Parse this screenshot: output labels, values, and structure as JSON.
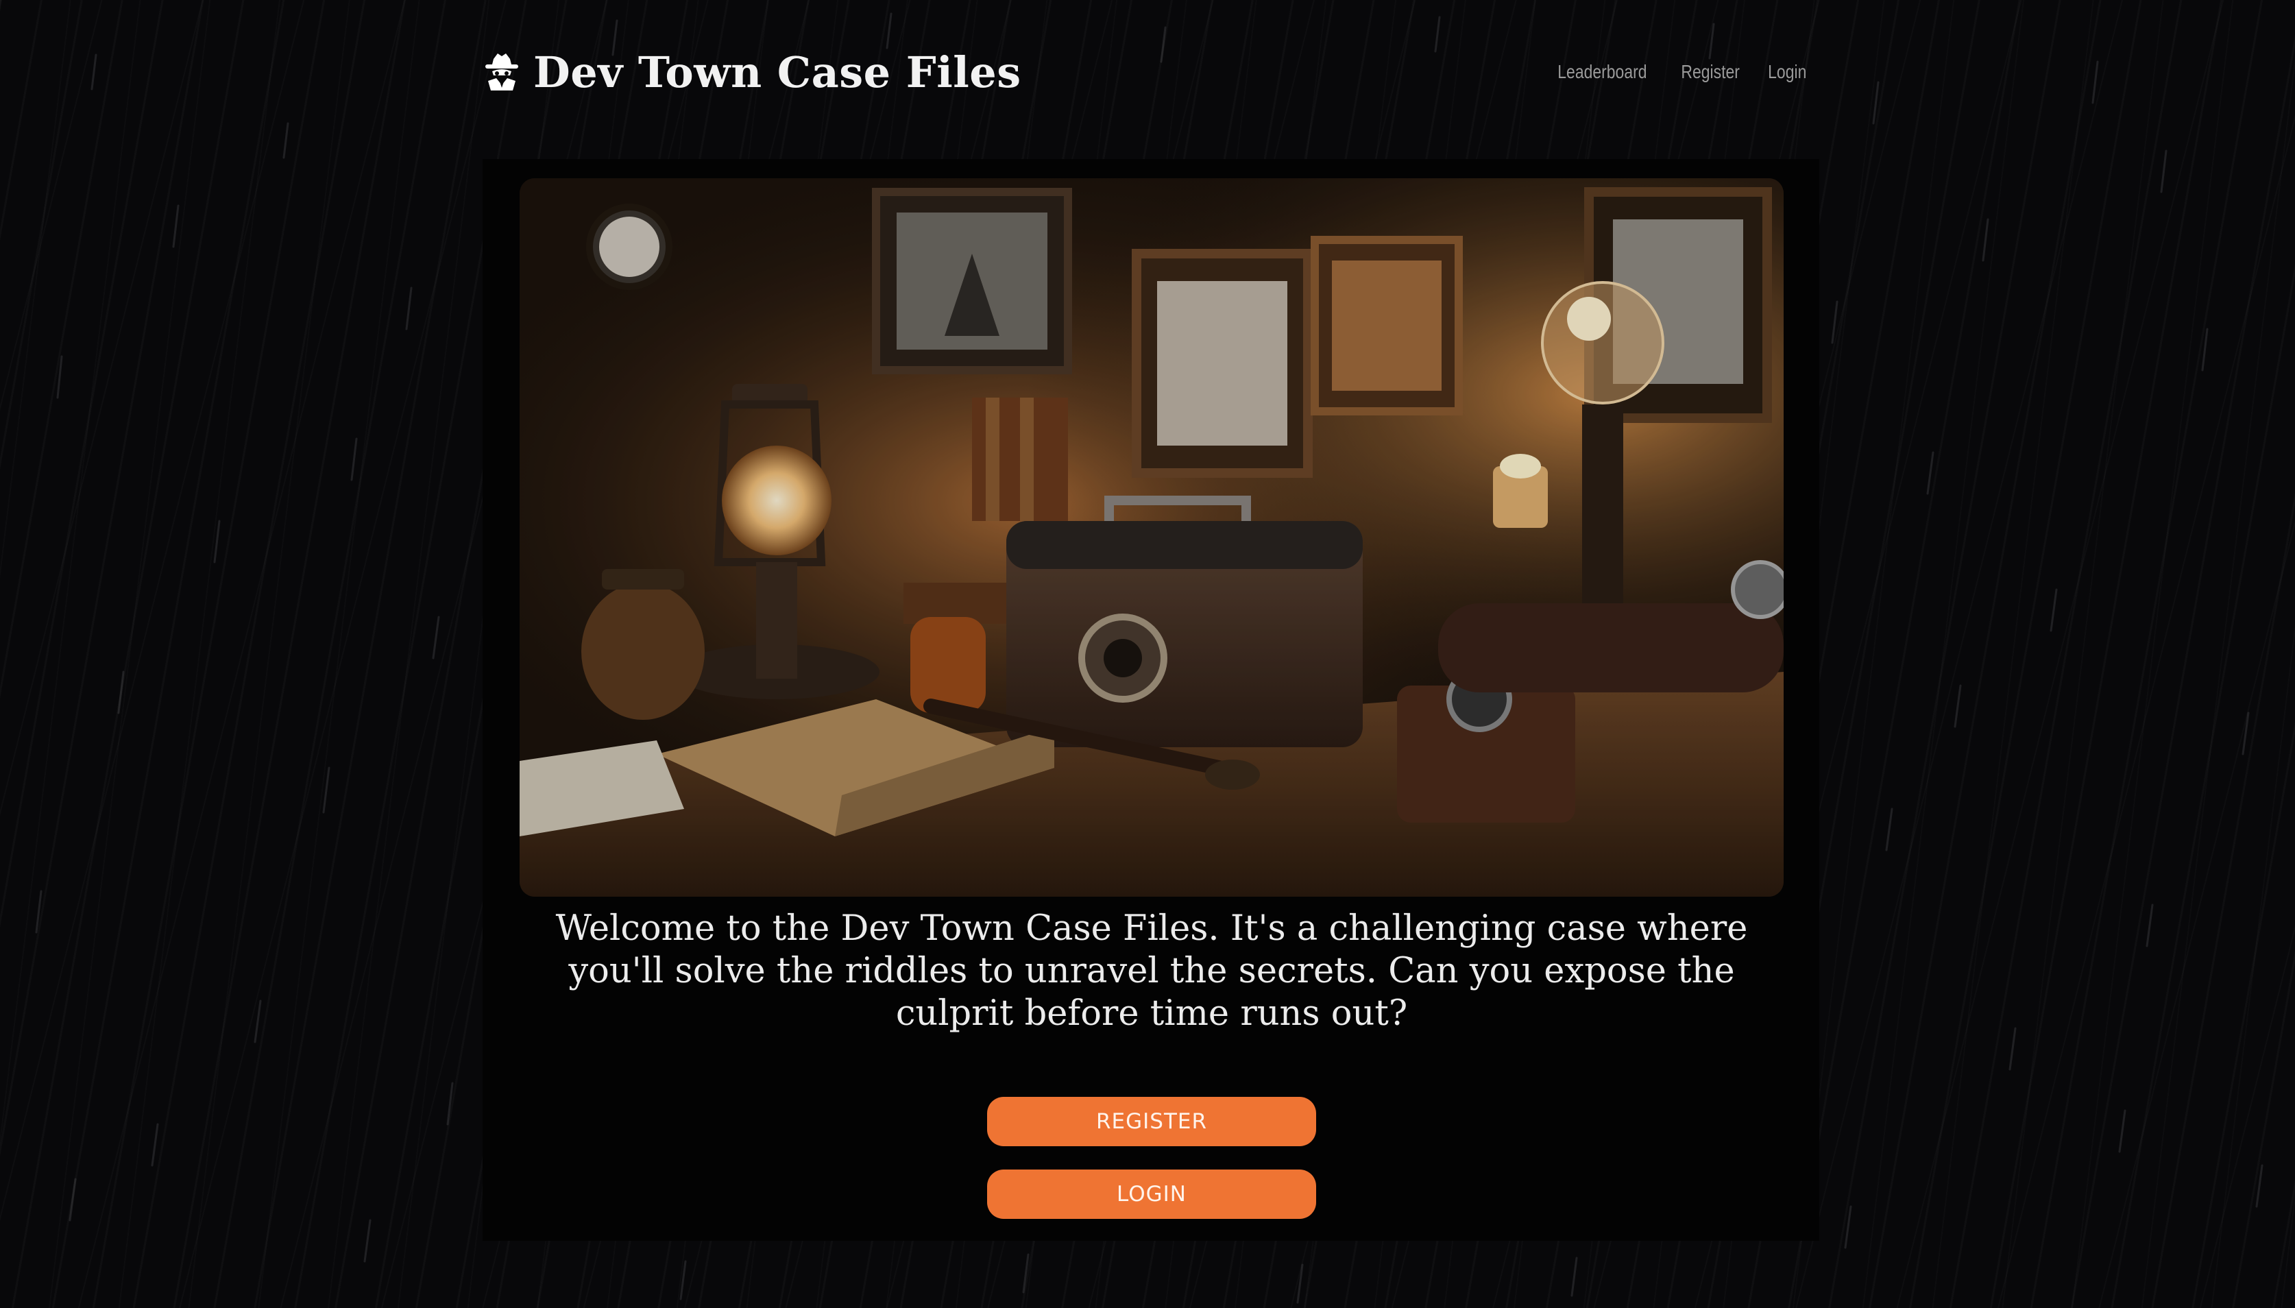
{
  "brand": {
    "title": "Dev Town Case Files",
    "icon": "detective-icon"
  },
  "nav": {
    "items": [
      {
        "label": "Leaderboard"
      },
      {
        "label": "Register"
      },
      {
        "label": "Login"
      }
    ]
  },
  "hero": {
    "image": "vintage-detective-desk-photo"
  },
  "intro": {
    "text": "Welcome to the Dev Town Case Files. It's a challenging case where you'll solve the riddles to unravel the secrets. Can you expose the culprit before time runs out?"
  },
  "buttons": {
    "register_label": "REGISTER",
    "login_label": "LOGIN"
  },
  "colors": {
    "accent": "#ef7433",
    "background": "#08080a",
    "card": "#030303"
  }
}
